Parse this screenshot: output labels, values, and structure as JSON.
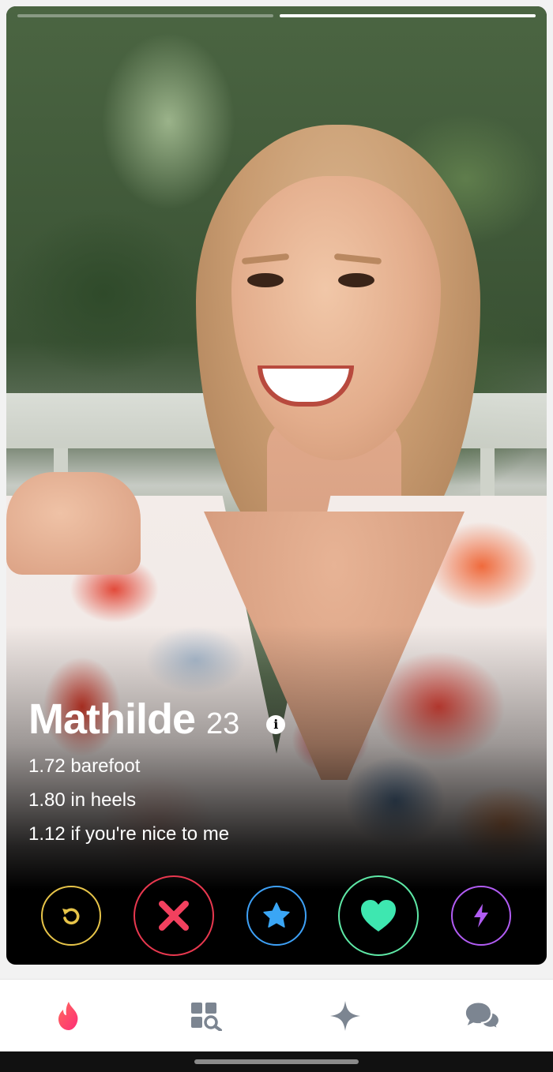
{
  "profile": {
    "name": "Mathilde",
    "age": "23",
    "bio": [
      "1.72 barefoot",
      "1.80 in heels",
      "1.12 if you're nice to me"
    ]
  },
  "photo_indicators": {
    "count": 2,
    "active_index": 1
  },
  "actions": [
    {
      "id": "rewind",
      "icon": "rewind-icon",
      "color": "#e7c449"
    },
    {
      "id": "nope",
      "icon": "close-icon",
      "color": "#e8384f"
    },
    {
      "id": "super_like",
      "icon": "star-icon",
      "color": "#3ea0f5"
    },
    {
      "id": "like",
      "icon": "heart-icon",
      "color": "#5ee8a6"
    },
    {
      "id": "boost",
      "icon": "lightning-icon",
      "color": "#b15cf3"
    }
  ],
  "bottom_nav": [
    {
      "id": "swipe",
      "icon": "flame-icon",
      "active": true,
      "color": "#fd3a73"
    },
    {
      "id": "explore",
      "icon": "explore-icon",
      "active": false,
      "color": "#7c8591"
    },
    {
      "id": "top_picks",
      "icon": "sparkle-icon",
      "active": false,
      "color": "#7c8591"
    },
    {
      "id": "messages",
      "icon": "chat-icon",
      "active": false,
      "color": "#7c8591"
    }
  ],
  "info_icon_glyph": "i"
}
